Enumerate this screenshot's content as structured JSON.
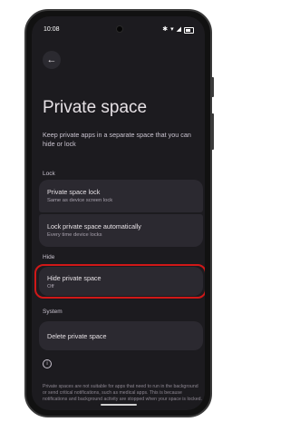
{
  "status_bar": {
    "time": "10:08"
  },
  "header": {
    "back_icon": "arrow-left-icon",
    "title": "Private space"
  },
  "description": "Keep private apps in a separate space that you can hide or lock",
  "sections": {
    "lock": "Lock",
    "hide": "Hide",
    "system": "System"
  },
  "lock_items": [
    {
      "title": "Private space lock",
      "subtitle": "Same as device screen lock"
    },
    {
      "title": "Lock private space automatically",
      "subtitle": "Every time device locks"
    }
  ],
  "hide_item": {
    "title": "Hide private space",
    "subtitle": "Off"
  },
  "system_item": {
    "title": "Delete private space"
  },
  "footer": "Private spaces are not suitable for apps that need to run in the background or send critical notifications, such as medical apps. This is because notifications and background activity are stopped when your space is locked.",
  "colors": {
    "background": "#1c1b1f",
    "card": "#2b2930",
    "highlight": "#d01818"
  }
}
